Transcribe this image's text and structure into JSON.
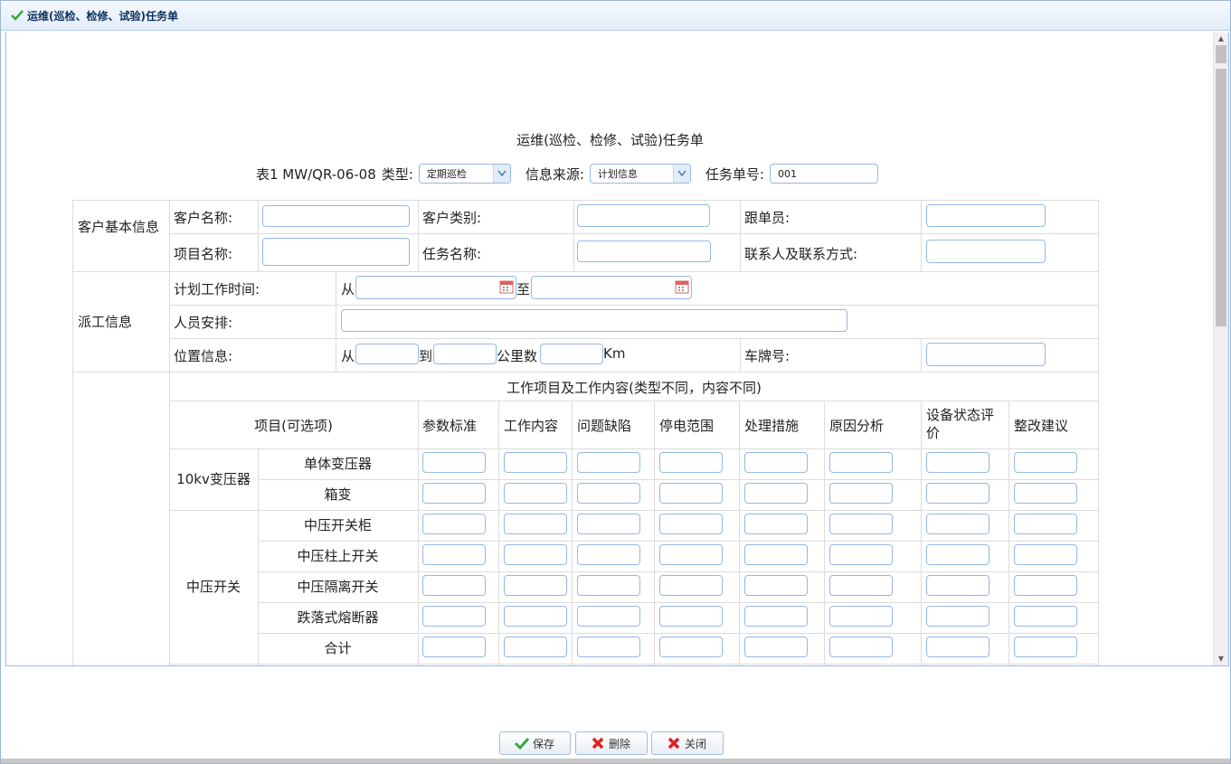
{
  "window": {
    "title": "运维(巡检、检修、试验)任务单"
  },
  "form": {
    "title": "运维(巡检、检修、试验)任务单",
    "table_code": "表1  MW/QR-06-08",
    "type_label": "类型:",
    "type_value": "定期巡检",
    "source_label": "信息来源:",
    "source_value": "计划信息",
    "task_no_label": "任务单号:",
    "task_no_value": "001"
  },
  "customer": {
    "section": "客户基本信息",
    "customer_name": "客户名称:",
    "customer_type": "客户类别:",
    "follower": "跟单员:",
    "project_name": "项目名称:",
    "task_name": "任务名称:",
    "contact": "联系人及联系方式:"
  },
  "dispatch": {
    "section": "派工信息",
    "plan_time": "计划工作时间:",
    "from": "从",
    "to_zhi": "至",
    "staff": "人员安排:",
    "location": "位置信息:",
    "loc_from": "从",
    "loc_to": "到",
    "km_label": "公里数",
    "km_unit": "Km",
    "plate": "车牌号:"
  },
  "work": {
    "header": "工作项目及工作内容(类型不同，内容不同)",
    "columns": [
      "项目(可选项)",
      "参数标准",
      "工作内容",
      "问题缺陷",
      "停电范围",
      "处理措施",
      "原因分析",
      "设备状态评价",
      "整改建议"
    ],
    "groups": [
      {
        "name": "10kv变压器",
        "items": [
          "单体变压器",
          "箱变"
        ]
      },
      {
        "name": "中压开关",
        "items": [
          "中压开关柜",
          "中压柱上开关",
          "中压隔离开关",
          "跌落式熔断器",
          "合计"
        ]
      }
    ]
  },
  "buttons": {
    "save": "保存",
    "delete": "删除",
    "close": "关闭"
  },
  "colors": {
    "border": "#95b8e7",
    "titlebar": "#e3edf9",
    "accent_green": "#3aa83a",
    "delete_red": "#e02020"
  }
}
